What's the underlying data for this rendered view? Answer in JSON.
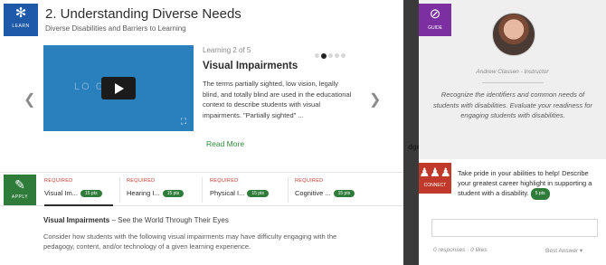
{
  "learn_tile": {
    "label": "LEARN"
  },
  "module": {
    "title": "2. Understanding Diverse Needs",
    "subtitle": "Diverse Disabilities and Barriers to Learning"
  },
  "video": {
    "ghost_text": "LO    ON"
  },
  "lesson": {
    "progress": "Learning 2 of 5",
    "current_index": 2,
    "total": 5,
    "heading": "Visual Impairments",
    "description": "The terms partially sighted, low vision, legally blind, and totally blind are used in the educational context to describe students with visual impairments. \"Partially sighted\" ...",
    "read_more": "Read More"
  },
  "apply_tile": {
    "label": "APPLY"
  },
  "requirements": [
    {
      "label": "REQUIRED",
      "name": "Visual Im...",
      "points": "15 pts"
    },
    {
      "label": "REQUIRED",
      "name": "Hearing I...",
      "points": "15 pts"
    },
    {
      "label": "REQUIRED",
      "name": "Physical I...",
      "points": "15 pts"
    },
    {
      "label": "REQUIRED",
      "name": "Cognitive ...",
      "points": "15 pts"
    }
  ],
  "activity": {
    "heading_bold": "Visual Impairments",
    "heading_rest": " – See the World Through Their Eyes",
    "body": "Consider how students with the following visual impairments may have difficulty engaging with the pedagogy, content, and/or technology of a given learning experience."
  },
  "guide": {
    "tile_label": "GUIDE",
    "instructor": "Andrew Classen - Instructor",
    "quote": "Recognize the identifiers and common needs of students with disabilities. Evaluate your readiness for engaging students with disabilities."
  },
  "connect": {
    "tile_label": "CONNECT",
    "prompt": "Take pride in your abilities to help! Describe your greatest career highlight in supporting a student with a disability.",
    "points": "5 pts",
    "reply_placeholder": "",
    "stats": "0 responses · 0 likes",
    "sort": "Best Answer ▾"
  },
  "background_fragment": "dge",
  "colors": {
    "learn": "#1e5aa8",
    "apply": "#2e7b3a",
    "guide": "#7b2fa0",
    "connect": "#c0392b",
    "link": "#2f8a3a"
  }
}
